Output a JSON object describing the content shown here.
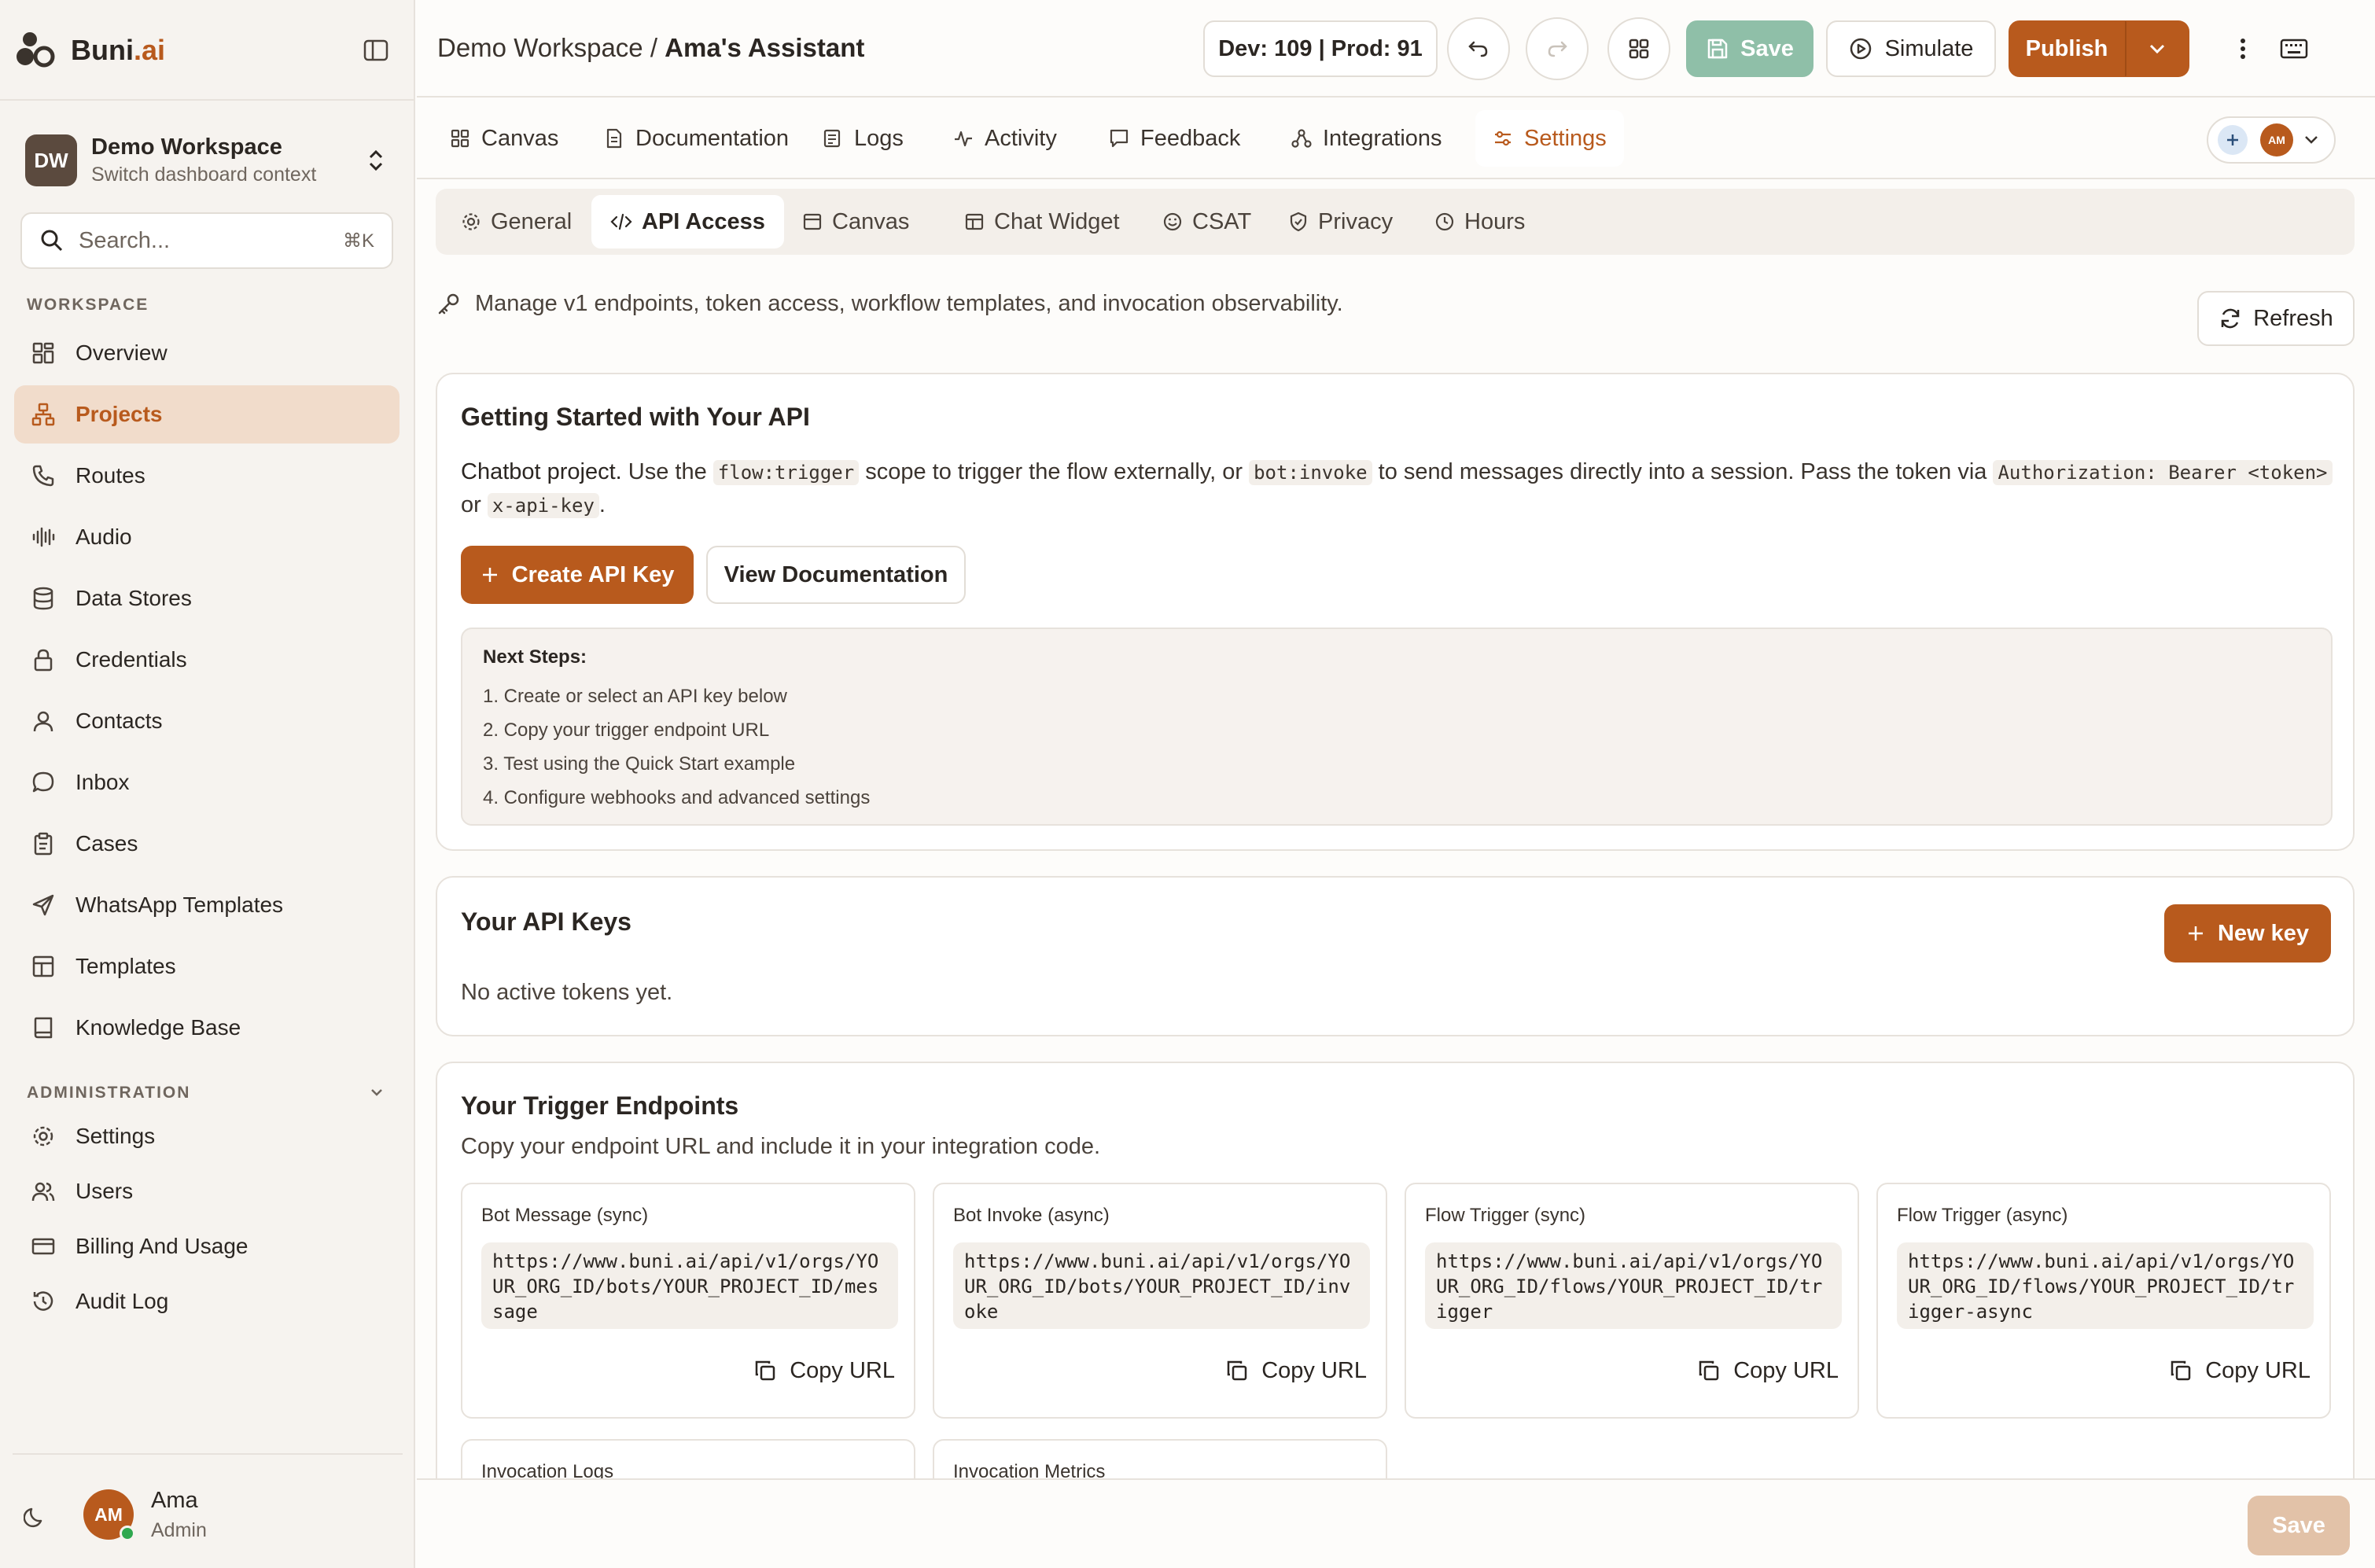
{
  "brand": {
    "name_main": "Buni",
    "name_suffix": ".ai"
  },
  "workspace": {
    "initials": "DW",
    "name": "Demo Workspace",
    "subtitle": "Switch dashboard context"
  },
  "search": {
    "placeholder": "Search...",
    "shortcut": "⌘K"
  },
  "sidebar": {
    "workspace_label": "WORKSPACE",
    "workspace_items": [
      {
        "label": "Overview",
        "icon": "grid-icon"
      },
      {
        "label": "Projects",
        "icon": "projects-icon",
        "active": true
      },
      {
        "label": "Routes",
        "icon": "phone-icon"
      },
      {
        "label": "Audio",
        "icon": "audio-icon"
      },
      {
        "label": "Data Stores",
        "icon": "database-icon"
      },
      {
        "label": "Credentials",
        "icon": "lock-icon"
      },
      {
        "label": "Contacts",
        "icon": "user-icon"
      },
      {
        "label": "Inbox",
        "icon": "chat-bubble-icon"
      },
      {
        "label": "Cases",
        "icon": "clipboard-icon"
      },
      {
        "label": "WhatsApp Templates",
        "icon": "send-icon"
      },
      {
        "label": "Templates",
        "icon": "layout-icon"
      },
      {
        "label": "Knowledge Base",
        "icon": "book-icon"
      }
    ],
    "admin_label": "ADMINISTRATION",
    "admin_items": [
      {
        "label": "Settings",
        "icon": "gear-icon"
      },
      {
        "label": "Users",
        "icon": "users-icon"
      },
      {
        "label": "Billing And Usage",
        "icon": "credit-card-icon"
      },
      {
        "label": "Audit Log",
        "icon": "history-icon"
      }
    ]
  },
  "user": {
    "initials": "AM",
    "name": "Ama",
    "role": "Admin"
  },
  "topbar": {
    "breadcrumb_workspace": "Demo Workspace",
    "breadcrumb_separator": " / ",
    "breadcrumb_project": "Ama's Assistant",
    "version_badge": "Dev: 109 | Prod: 91",
    "save_label": "Save",
    "simulate_label": "Simulate",
    "publish_label": "Publish"
  },
  "tabs": [
    {
      "label": "Canvas",
      "icon": "canvas-icon"
    },
    {
      "label": "Documentation",
      "icon": "document-icon"
    },
    {
      "label": "Logs",
      "icon": "logs-icon"
    },
    {
      "label": "Activity",
      "icon": "activity-icon"
    },
    {
      "label": "Feedback",
      "icon": "feedback-icon"
    },
    {
      "label": "Integrations",
      "icon": "integrations-icon"
    },
    {
      "label": "Settings",
      "icon": "sliders-icon",
      "active": true
    }
  ],
  "tab_avatar_initials": "AM",
  "subtabs": [
    {
      "label": "General",
      "icon": "gear-icon"
    },
    {
      "label": "API Access",
      "icon": "code-icon",
      "active": true
    },
    {
      "label": "Canvas",
      "icon": "canvas-icon"
    },
    {
      "label": "Chat Widget",
      "icon": "widget-icon"
    },
    {
      "label": "CSAT",
      "icon": "smile-icon"
    },
    {
      "label": "Privacy",
      "icon": "shield-icon"
    },
    {
      "label": "Hours",
      "icon": "clock-icon"
    }
  ],
  "page": {
    "description": "Manage v1 endpoints, token access, workflow templates, and invocation observability.",
    "refresh_label": "Refresh"
  },
  "getting_started": {
    "title": "Getting Started with Your API",
    "lead": "Chatbot project.",
    "text_1": " Use the ",
    "code_1": "flow:trigger",
    "text_2": " scope to trigger the flow externally, or ",
    "code_2": "bot:invoke",
    "text_3": " to send messages directly into a session. Pass the token via ",
    "code_3": "Authorization: Bearer <token>",
    "text_4": " or ",
    "code_4": "x-api-key",
    "text_5": ".",
    "create_key_label": "Create API Key",
    "view_docs_label": "View Documentation",
    "next_steps_title": "Next Steps:",
    "next_steps": [
      "1. Create or select an API key below",
      "2. Copy your trigger endpoint URL",
      "3. Test using the Quick Start example",
      "4. Configure webhooks and advanced settings"
    ]
  },
  "api_keys": {
    "title": "Your API Keys",
    "new_key_label": "New key",
    "empty_text": "No active tokens yet."
  },
  "endpoints": {
    "title": "Your Trigger Endpoints",
    "subtitle": "Copy your endpoint URL and include it in your integration code.",
    "items": [
      {
        "title": "Bot Message (sync)",
        "url": "https://www.buni.ai/api/v1/orgs/YOUR_ORG_ID/bots/YOUR_PROJECT_ID/message",
        "copy_label": "Copy URL"
      },
      {
        "title": "Bot Invoke (async)",
        "url": "https://www.buni.ai/api/v1/orgs/YOUR_ORG_ID/bots/YOUR_PROJECT_ID/invoke",
        "copy_label": "Copy URL"
      },
      {
        "title": "Flow Trigger (sync)",
        "url": "https://www.buni.ai/api/v1/orgs/YOUR_ORG_ID/flows/YOUR_PROJECT_ID/trigger",
        "copy_label": "Copy URL"
      },
      {
        "title": "Flow Trigger (async)",
        "url": "https://www.buni.ai/api/v1/orgs/YOUR_ORG_ID/flows/YOUR_PROJECT_ID/trigger-async",
        "copy_label": "Copy URL"
      }
    ],
    "more": [
      {
        "title": "Invocation Logs"
      },
      {
        "title": "Invocation Metrics"
      }
    ]
  },
  "footer": {
    "save_label": "Save"
  },
  "colors": {
    "accent": "#b85a1d",
    "accent_soft": "#f1dccb",
    "save_disabled": "#8fbfa8",
    "online": "#2fa84f"
  }
}
